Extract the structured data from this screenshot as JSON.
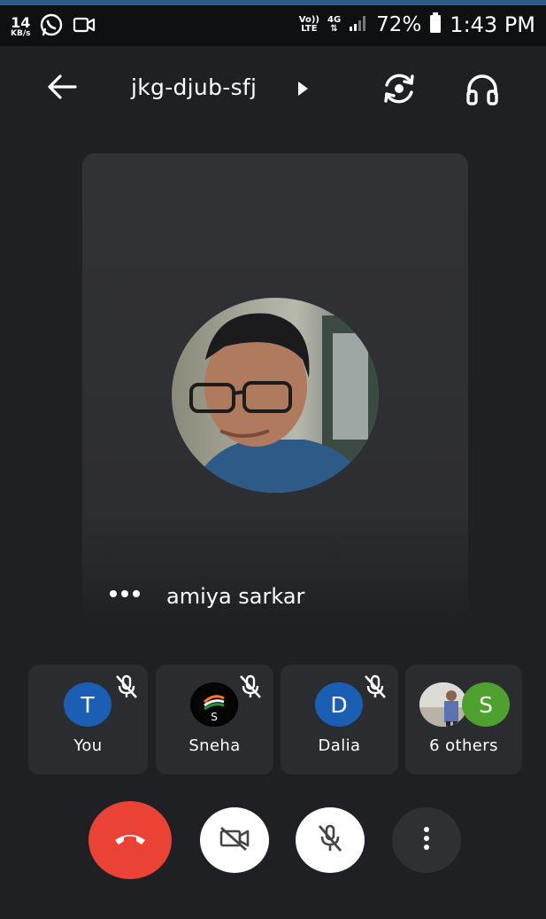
{
  "status_bar": {
    "speed_value": "14",
    "speed_unit": "KB/s",
    "volte_top": "Vo))",
    "volte_bottom": "LTE",
    "network": "4G",
    "battery": "72%",
    "time": "1:43 PM"
  },
  "header": {
    "meeting_code": "jkg-djub-sfj"
  },
  "main_tile": {
    "name": "amiya sarkar"
  },
  "participants": [
    {
      "name": "You",
      "initial": "T",
      "color": "#1a5fb4",
      "muted": true
    },
    {
      "name": "Sneha",
      "initial": "S",
      "color": "#000000",
      "muted": true
    },
    {
      "name": "Dalia",
      "initial": "D",
      "color": "#1a5fb4",
      "muted": true
    },
    {
      "name": "6 others",
      "initial": "S",
      "color": "#4fa12e",
      "muted": false
    }
  ],
  "controls": {
    "end_call_color": "#ea4335",
    "camera_state": "off",
    "mic_state": "off"
  }
}
